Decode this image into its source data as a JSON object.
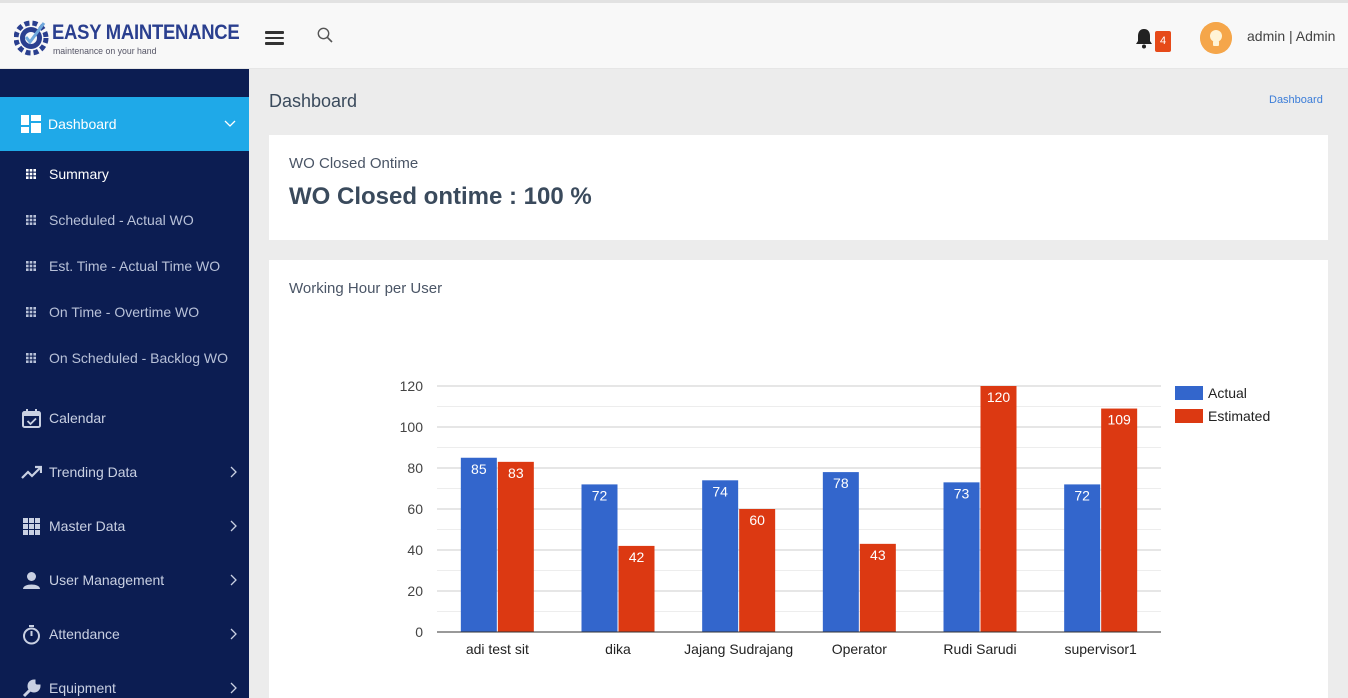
{
  "header": {
    "logo_title": "EASY MAINTENANCE",
    "logo_subtitle": "maintenance on your hand",
    "notification_count": "4",
    "user_label": "admin | Admin"
  },
  "sidebar": {
    "active": {
      "label": "Dashboard",
      "icon": "dashboard-icon"
    },
    "sub_items": [
      {
        "label": "Summary",
        "current": true
      },
      {
        "label": "Scheduled - Actual WO"
      },
      {
        "label": "Est. Time - Actual Time WO"
      },
      {
        "label": "On Time - Overtime WO"
      },
      {
        "label": "On Scheduled - Backlog WO"
      }
    ],
    "items": [
      {
        "label": "Calendar",
        "icon": "calendar-icon"
      },
      {
        "label": "Trending Data",
        "icon": "trending-icon"
      },
      {
        "label": "Master Data",
        "icon": "grid-icon"
      },
      {
        "label": "User Management",
        "icon": "user-icon"
      },
      {
        "label": "Attendance",
        "icon": "stopwatch-icon"
      },
      {
        "label": "Equipment",
        "icon": "wrench-icon"
      }
    ]
  },
  "main": {
    "page_title": "Dashboard",
    "breadcrumb": "Dashboard",
    "wo_card": {
      "title": "WO Closed Ontime",
      "value": "WO Closed ontime : 100 %"
    },
    "chart_card": {
      "title": "Working Hour per User"
    }
  },
  "colors": {
    "sidebar_bg": "#0c1d52",
    "active_bg": "#1fa9e8",
    "actual": "#3366cc",
    "estimated": "#dc3912"
  },
  "chart_data": {
    "type": "bar",
    "categories": [
      "adi test sit",
      "dika",
      "Jajang Sudrajang",
      "Operator",
      "Rudi Sarudi",
      "supervisor1"
    ],
    "series": [
      {
        "name": "Actual",
        "values": [
          85,
          72,
          74,
          78,
          73,
          72
        ],
        "color": "#3366cc"
      },
      {
        "name": "Estimated",
        "values": [
          83,
          42,
          60,
          43,
          120,
          109
        ],
        "color": "#dc3912"
      }
    ],
    "ylim": [
      0,
      120
    ],
    "yticks": [
      0,
      20,
      40,
      60,
      80,
      100,
      120
    ],
    "grid": true,
    "legend": "right"
  }
}
